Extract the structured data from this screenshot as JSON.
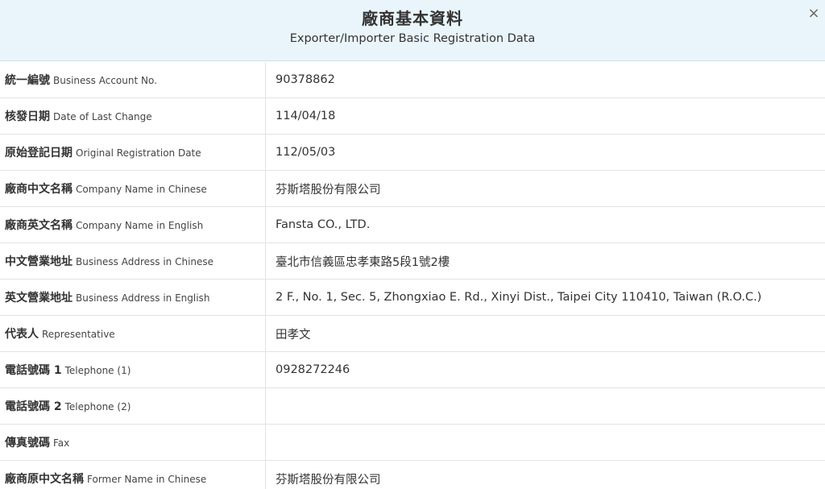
{
  "header": {
    "title_zh": "廠商基本資料",
    "title_en": "Exporter/Importer Basic Registration Data",
    "close_glyph": "×"
  },
  "rows": [
    {
      "label_zh": "統一編號",
      "label_en": "Business Account No.",
      "value": "90378862"
    },
    {
      "label_zh": "核發日期",
      "label_en": "Date of Last Change",
      "value": "114/04/18"
    },
    {
      "label_zh": "原始登記日期",
      "label_en": "Original Registration Date",
      "value": "112/05/03"
    },
    {
      "label_zh": "廠商中文名稱",
      "label_en": "Company Name in Chinese",
      "value": "芬斯塔股份有限公司"
    },
    {
      "label_zh": "廠商英文名稱",
      "label_en": "Company Name in English",
      "value": "Fansta CO., LTD."
    },
    {
      "label_zh": "中文營業地址",
      "label_en": "Business Address in Chinese",
      "value": "臺北市信義區忠孝東路5段1號2樓"
    },
    {
      "label_zh": "英文營業地址",
      "label_en": "Business Address in English",
      "value": "2 F., No. 1, Sec. 5, Zhongxiao E. Rd., Xinyi Dist., Taipei City 110410, Taiwan (R.O.C.)"
    },
    {
      "label_zh": "代表人",
      "label_en": "Representative",
      "value": "田孝文"
    },
    {
      "label_zh": "電話號碼 1",
      "label_en": "Telephone (1)",
      "value": "0928272246"
    },
    {
      "label_zh": "電話號碼 2",
      "label_en": "Telephone (2)",
      "value": ""
    },
    {
      "label_zh": "傳真號碼",
      "label_en": "Fax",
      "value": ""
    },
    {
      "label_zh": "廠商原中文名稱",
      "label_en": "Former Name in Chinese",
      "value": "芬斯塔股份有限公司"
    }
  ]
}
